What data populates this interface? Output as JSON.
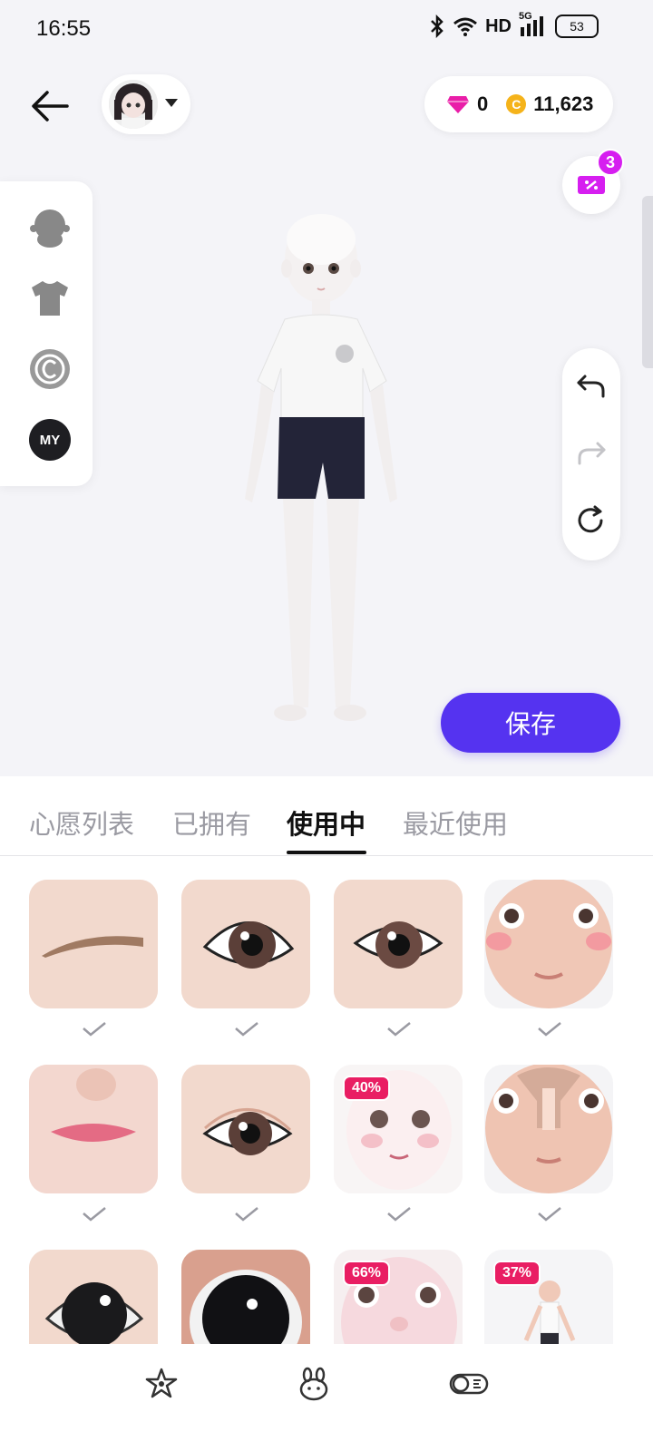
{
  "status_bar": {
    "time": "16:55",
    "network": "HD",
    "cell": "5G",
    "battery": "53"
  },
  "header": {
    "back_icon": "arrow-left-icon",
    "avatar_icon": "avatar-thumbnail",
    "diamonds": "0",
    "coin_symbol": "C",
    "coins": "11,623",
    "coupon_badge": "3"
  },
  "side_menu": {
    "items": [
      "head-icon",
      "tshirt-icon",
      "copyright-icon",
      "MY"
    ]
  },
  "tools": {
    "items": [
      "undo-icon",
      "redo-icon",
      "reset-icon"
    ]
  },
  "actions": {
    "save_label": "保存"
  },
  "tabs": [
    {
      "label": "心愿列表",
      "active": false
    },
    {
      "label": "已拥有",
      "active": false
    },
    {
      "label": "使用中",
      "active": true
    },
    {
      "label": "最近使用",
      "active": false
    }
  ],
  "items": {
    "badges": {
      "r2c3": "40%",
      "r3c3": "66%",
      "r3c4": "37%"
    }
  },
  "colors": {
    "accent": "#5533f0",
    "discount": "#e91e63",
    "coupon_badge": "#d61ef0"
  },
  "bottom_nav": [
    "sparkle-star-icon",
    "bunny-icon",
    "toggle-icon"
  ]
}
